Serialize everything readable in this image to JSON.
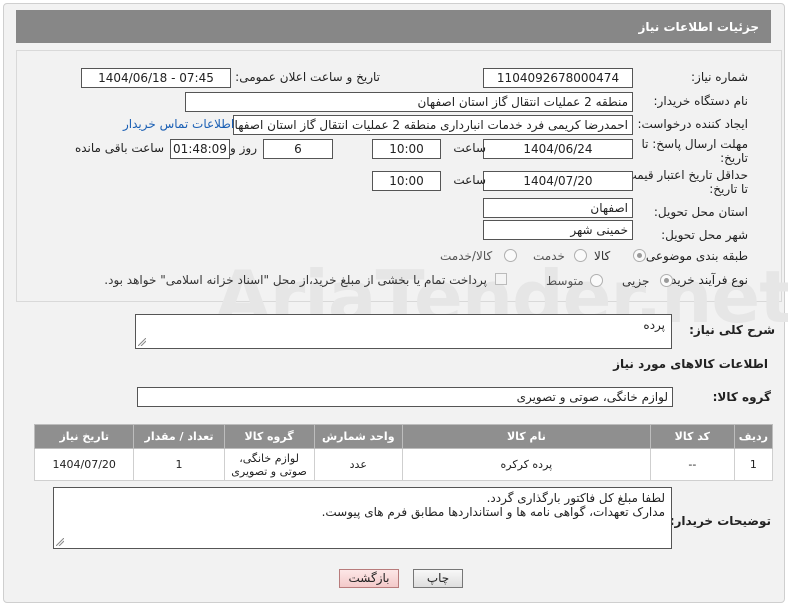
{
  "header": {
    "title": "جزئیات اطلاعات نیاز"
  },
  "watermark": "AriaTender.net",
  "form": {
    "need_number": {
      "label": "شماره نیاز:",
      "value": "1104092678000474"
    },
    "announce": {
      "label": "تاریخ و ساعت اعلان عمومی:",
      "value": "1404/06/18 - 07:45"
    },
    "buyer_org": {
      "label": "نام دستگاه خریدار:",
      "value": "منطقه 2 عملیات انتقال گاز استان اصفهان"
    },
    "requester": {
      "label": "ایجاد کننده درخواست:",
      "value": "احمدرضا کریمی فرد خدمات انبارداری منطقه 2 عملیات انتقال گاز استان اصفهان",
      "contact_link": "اطلاعات تماس خریدار"
    },
    "deadline": {
      "label": "مهلت ارسال پاسخ: تا تاریخ:",
      "date": "1404/06/24",
      "time_label": "ساعت",
      "time": "10:00",
      "days": "6",
      "days_label": "روز و",
      "remaining": "01:48:09",
      "remaining_label": "ساعت باقی مانده"
    },
    "price_validity": {
      "label": "حداقل تاریخ اعتبار قیمت: تا تاریخ:",
      "date": "1404/07/20",
      "time_label": "ساعت",
      "time": "10:00"
    },
    "province": {
      "label": "استان محل تحویل:",
      "value": "اصفهان"
    },
    "city": {
      "label": "شهر محل تحویل:",
      "value": "خمینی شهر"
    },
    "category": {
      "label": "طبقه بندی موضوعی:",
      "options": [
        "کالا",
        "خدمت",
        "کالا/خدمت"
      ],
      "selected": "کالا"
    },
    "process": {
      "label": "نوع فرآیند خرید :",
      "options": [
        "جزیی",
        "متوسط"
      ],
      "selected": "جزیی",
      "checkbox_text": "پرداخت تمام یا بخشی از مبلغ خرید،از محل \"اسناد خزانه اسلامی\" خواهد بود."
    }
  },
  "description": {
    "label": "شرح کلی نیاز:",
    "value": "پرده"
  },
  "goods_section": {
    "title": "اطلاعات کالاهای مورد نیاز"
  },
  "goods_group": {
    "label": "گروه کالا:",
    "value": "لوازم خانگی، صوتی و تصویری"
  },
  "table": {
    "headers": [
      "ردیف",
      "کد کالا",
      "نام کالا",
      "واحد شمارش",
      "گروه کالا",
      "تعداد / مقدار",
      "تاریخ نیاز"
    ],
    "rows": [
      {
        "row": "1",
        "code": "--",
        "name": "پرده کرکره",
        "unit": "عدد",
        "group": "لوازم خانگی، صوتی و تصویری",
        "qty": "1",
        "date": "1404/07/20"
      }
    ]
  },
  "buyer_notes": {
    "label": "توضیحات خریدار:",
    "line1": "لطفا مبلغ کل فاکتور بارگذاری گردد.",
    "line2": "مدارک تعهدات، گواهی نامه ها و استانداردها مطابق فرم های پیوست."
  },
  "buttons": {
    "print": "چاپ",
    "back": "بازگشت"
  }
}
